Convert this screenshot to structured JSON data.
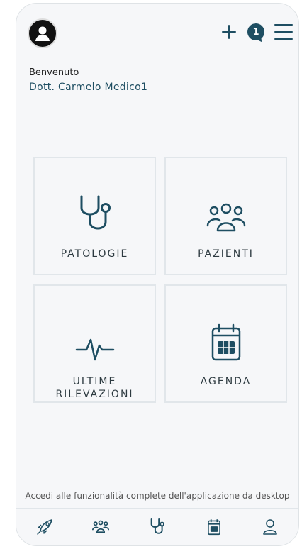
{
  "header": {
    "notification_count": "1",
    "icons": [
      "user-avatar-icon",
      "plus-icon",
      "notification-badge",
      "hamburger-menu-icon"
    ]
  },
  "welcome": {
    "greeting": "Benvenuto",
    "doctor_name": "Dott. Carmelo Medico1"
  },
  "tiles": [
    {
      "label": "PATOLOGIE",
      "icon": "stethoscope-icon"
    },
    {
      "label": "PAZIENTI",
      "icon": "users-icon"
    },
    {
      "label": "ULTIME\nRILEVAZIONI",
      "icon": "heartbeat-icon"
    },
    {
      "label": "AGENDA",
      "icon": "calendar-icon"
    }
  ],
  "hint": "Accedi alle funzionalità complete dell'applicazione da desktop",
  "bottom_nav": [
    "rocket-icon",
    "users-icon",
    "stethoscope-icon",
    "calendar-icon",
    "user-icon"
  ],
  "colors": {
    "accent": "#1e4e62",
    "background": "#f6f7f9",
    "tile_border": "#e1e6ea"
  }
}
